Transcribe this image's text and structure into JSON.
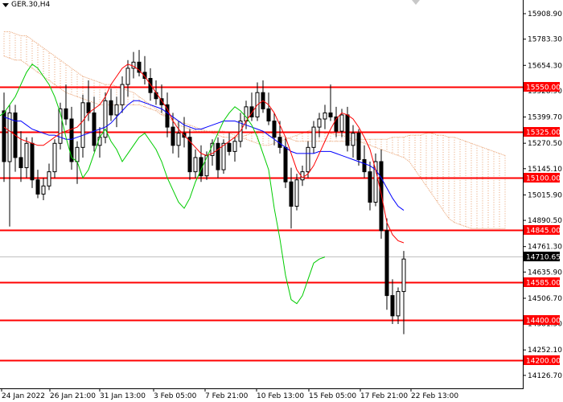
{
  "symbol": "GER.30,H4",
  "price_scale": {
    "ticks": [
      "15908.90",
      "15783.30",
      "15654.30",
      "15528.90",
      "15399.70",
      "15270.50",
      "15145.10",
      "15015.90",
      "14890.50",
      "14761.30",
      "14635.90",
      "14506.70",
      "14381.50",
      "14252.10",
      "14126.70"
    ]
  },
  "time_scale": {
    "ticks": [
      "24 Jan 2022",
      "26 Jan 21:00",
      "31 Jan 13:00",
      "3 Feb 05:00",
      "7 Feb 21:00",
      "10 Feb 13:00",
      "15 Feb 05:00",
      "17 Feb 21:00",
      "22 Feb 13:00"
    ]
  },
  "levels": [
    {
      "value": 15550.0,
      "label": "15550.00"
    },
    {
      "value": 15325.0,
      "label": "15325.00"
    },
    {
      "value": 15100.0,
      "label": "15100.00"
    },
    {
      "value": 14845.0,
      "label": "14845.00"
    },
    {
      "value": 14585.0,
      "label": "14585.00"
    },
    {
      "value": 14400.0,
      "label": "14400.00"
    },
    {
      "value": 14200.0,
      "label": "14200.00"
    }
  ],
  "current_price": {
    "value": 14710.65,
    "label": "14710.65"
  },
  "colors": {
    "level_line": "#ff0000",
    "candle": "#000000",
    "tenkan": "#ff0000",
    "kijun": "#0000ff",
    "chikou": "#00cc00",
    "kumo": "#e8a070",
    "current_price_line": "#c0c0c0"
  },
  "chart_data": {
    "type": "candlestick",
    "indicator": "ichimoku",
    "ylim": [
      14095,
      15960
    ],
    "candles": [
      [
        15430,
        15520,
        15080,
        15180
      ],
      [
        15180,
        15460,
        14860,
        15420
      ],
      [
        15420,
        15460,
        15130,
        15200
      ],
      [
        15200,
        15330,
        15080,
        15150
      ],
      [
        15150,
        15300,
        15100,
        15270
      ],
      [
        15270,
        15300,
        15050,
        15090
      ],
      [
        15090,
        15140,
        15000,
        15020
      ],
      [
        15020,
        15100,
        14990,
        15060
      ],
      [
        15060,
        15170,
        15040,
        15130
      ],
      [
        15130,
        15290,
        15100,
        15270
      ],
      [
        15270,
        15470,
        15240,
        15440
      ],
      [
        15440,
        15560,
        15360,
        15390
      ],
      [
        15390,
        15450,
        15140,
        15180
      ],
      [
        15180,
        15280,
        15070,
        15250
      ],
      [
        15250,
        15510,
        15200,
        15470
      ],
      [
        15470,
        15580,
        15380,
        15420
      ],
      [
        15420,
        15500,
        15230,
        15260
      ],
      [
        15260,
        15350,
        15200,
        15300
      ],
      [
        15300,
        15520,
        15270,
        15480
      ],
      [
        15480,
        15540,
        15380,
        15410
      ],
      [
        15410,
        15500,
        15350,
        15460
      ],
      [
        15460,
        15600,
        15420,
        15560
      ],
      [
        15560,
        15680,
        15500,
        15640
      ],
      [
        15640,
        15720,
        15590,
        15670
      ],
      [
        15670,
        15730,
        15600,
        15620
      ],
      [
        15620,
        15700,
        15560,
        15590
      ],
      [
        15590,
        15640,
        15480,
        15520
      ],
      [
        15520,
        15580,
        15460,
        15490
      ],
      [
        15490,
        15560,
        15420,
        15460
      ],
      [
        15460,
        15520,
        15300,
        15350
      ],
      [
        15350,
        15420,
        15220,
        15260
      ],
      [
        15260,
        15380,
        15200,
        15320
      ],
      [
        15320,
        15400,
        15250,
        15300
      ],
      [
        15300,
        15340,
        15090,
        15130
      ],
      [
        15130,
        15240,
        15100,
        15200
      ],
      [
        15200,
        15260,
        15080,
        15110
      ],
      [
        15110,
        15230,
        15090,
        15210
      ],
      [
        15210,
        15290,
        15160,
        15270
      ],
      [
        15270,
        15300,
        15100,
        15140
      ],
      [
        15140,
        15290,
        15120,
        15270
      ],
      [
        15270,
        15320,
        15210,
        15230
      ],
      [
        15230,
        15300,
        15180,
        15280
      ],
      [
        15280,
        15420,
        15250,
        15380
      ],
      [
        15380,
        15480,
        15340,
        15450
      ],
      [
        15450,
        15520,
        15380,
        15400
      ],
      [
        15400,
        15570,
        15380,
        15520
      ],
      [
        15520,
        15580,
        15420,
        15440
      ],
      [
        15440,
        15520,
        15360,
        15380
      ],
      [
        15380,
        15420,
        15260,
        15300
      ],
      [
        15300,
        15380,
        15220,
        15250
      ],
      [
        15250,
        15300,
        15050,
        15080
      ],
      [
        15080,
        15150,
        14850,
        14960
      ],
      [
        14960,
        15120,
        14940,
        15090
      ],
      [
        15090,
        15160,
        15060,
        15130
      ],
      [
        15130,
        15280,
        15100,
        15250
      ],
      [
        15250,
        15380,
        15220,
        15350
      ],
      [
        15350,
        15420,
        15300,
        15390
      ],
      [
        15390,
        15460,
        15340,
        15420
      ],
      [
        15420,
        15560,
        15380,
        15400
      ],
      [
        15400,
        15450,
        15300,
        15330
      ],
      [
        15330,
        15440,
        15300,
        15410
      ],
      [
        15410,
        15450,
        15230,
        15260
      ],
      [
        15260,
        15360,
        15200,
        15320
      ],
      [
        15320,
        15340,
        15160,
        15190
      ],
      [
        15190,
        15260,
        15100,
        15130
      ],
      [
        15130,
        15180,
        14940,
        14980
      ],
      [
        14980,
        15220,
        14960,
        15180
      ],
      [
        15180,
        15240,
        14800,
        14840
      ],
      [
        14840,
        14900,
        14450,
        14520
      ],
      [
        14520,
        14600,
        14380,
        14420
      ],
      [
        14420,
        14560,
        14380,
        14540
      ],
      [
        14540,
        14740,
        14330,
        14700
      ]
    ],
    "ichimoku": {
      "tenkan": [
        15350,
        15330,
        15310,
        15290,
        15280,
        15270,
        15260,
        15260,
        15280,
        15300,
        15320,
        15330,
        15340,
        15350,
        15380,
        15420,
        15440,
        15460,
        15500,
        15560,
        15600,
        15640,
        15660,
        15650,
        15630,
        15600,
        15560,
        15520,
        15480,
        15440,
        15380,
        15340,
        15310,
        15280,
        15250,
        15220,
        15210,
        15220,
        15240,
        15260,
        15280,
        15300,
        15330,
        15380,
        15420,
        15460,
        15480,
        15460,
        15420,
        15360,
        15300,
        15220,
        15140,
        15100,
        15120,
        15160,
        15220,
        15280,
        15340,
        15390,
        15420,
        15410,
        15390,
        15350,
        15300,
        15240,
        15140,
        15020,
        14880,
        14820,
        14790,
        14780
      ],
      "kijun": [
        15400,
        15390,
        15380,
        15380,
        15360,
        15340,
        15330,
        15320,
        15310,
        15310,
        15300,
        15290,
        15290,
        15300,
        15310,
        15320,
        15330,
        15340,
        15350,
        15370,
        15400,
        15430,
        15460,
        15480,
        15480,
        15470,
        15460,
        15450,
        15440,
        15420,
        15400,
        15380,
        15360,
        15350,
        15340,
        15340,
        15350,
        15360,
        15370,
        15380,
        15380,
        15380,
        15370,
        15360,
        15350,
        15340,
        15330,
        15310,
        15290,
        15270,
        15250,
        15230,
        15220,
        15220,
        15220,
        15220,
        15230,
        15230,
        15230,
        15220,
        15210,
        15200,
        15190,
        15180,
        15170,
        15160,
        15140,
        15100,
        15050,
        15000,
        14960,
        14940
      ],
      "chikou": [
        15540,
        15420,
        15360,
        15400,
        15420,
        15460,
        15500,
        15560,
        15620,
        15660,
        15640,
        15600,
        15560,
        15500,
        15420,
        15300,
        15200,
        15180,
        15100,
        15140,
        15220,
        15300,
        15340,
        15280,
        15240,
        15180,
        15220,
        15260,
        15300,
        15320,
        15280,
        15240,
        15180,
        15100,
        15040,
        14980,
        14950,
        15000,
        15080,
        15140,
        15200,
        15260,
        15320,
        15380,
        15420,
        15450,
        15430,
        15400,
        15360,
        15300,
        15220,
        15140,
        14950,
        14800,
        14620,
        14500,
        14480,
        14520,
        14600,
        14680,
        14700,
        14710
      ]
    },
    "kumo": {
      "span_a": [
        15700,
        15690,
        15680,
        15680,
        15660,
        15640,
        15620,
        15600,
        15580,
        15560,
        15540,
        15520,
        15510,
        15500,
        15490,
        15480,
        15470,
        15460,
        15460,
        15460,
        15460,
        15460,
        15460,
        15460,
        15460,
        15450,
        15440,
        15430,
        15410,
        15400,
        15390,
        15380,
        15370,
        15360,
        15350,
        15340,
        15330,
        15320,
        15310,
        15300,
        15300,
        15300,
        15300,
        15310,
        15320,
        15330,
        15330,
        15320,
        15320,
        15310,
        15300,
        15290,
        15280,
        15280,
        15280,
        15280,
        15280,
        15280,
        15280,
        15280,
        15280,
        15280,
        15290,
        15290,
        15290,
        15290,
        15290,
        15290,
        15290,
        15300,
        15300,
        15300,
        15310,
        15310,
        15310,
        15320,
        15320,
        15310,
        15310,
        15300,
        15300,
        15290,
        15280,
        15270,
        15260,
        15250,
        15240,
        15230,
        15220,
        15210
      ],
      "span_b": [
        15820,
        15820,
        15810,
        15800,
        15800,
        15780,
        15760,
        15740,
        15720,
        15700,
        15680,
        15660,
        15640,
        15620,
        15600,
        15590,
        15580,
        15570,
        15560,
        15560,
        15550,
        15540,
        15530,
        15520,
        15500,
        15480,
        15460,
        15440,
        15420,
        15400,
        15380,
        15360,
        15350,
        15340,
        15330,
        15330,
        15330,
        15330,
        15330,
        15330,
        15320,
        15310,
        15300,
        15290,
        15280,
        15270,
        15260,
        15260,
        15270,
        15280,
        15290,
        15300,
        15310,
        15320,
        15330,
        15340,
        15330,
        15320,
        15320,
        15310,
        15310,
        15300,
        15290,
        15280,
        15270,
        15260,
        15250,
        15240,
        15230,
        15220,
        15210,
        15200,
        15180,
        15140,
        15100,
        15060,
        15020,
        14980,
        14940,
        14900,
        14880,
        14870,
        14860,
        14850,
        14850,
        14850,
        14850,
        14850,
        14850,
        14850
      ]
    }
  }
}
